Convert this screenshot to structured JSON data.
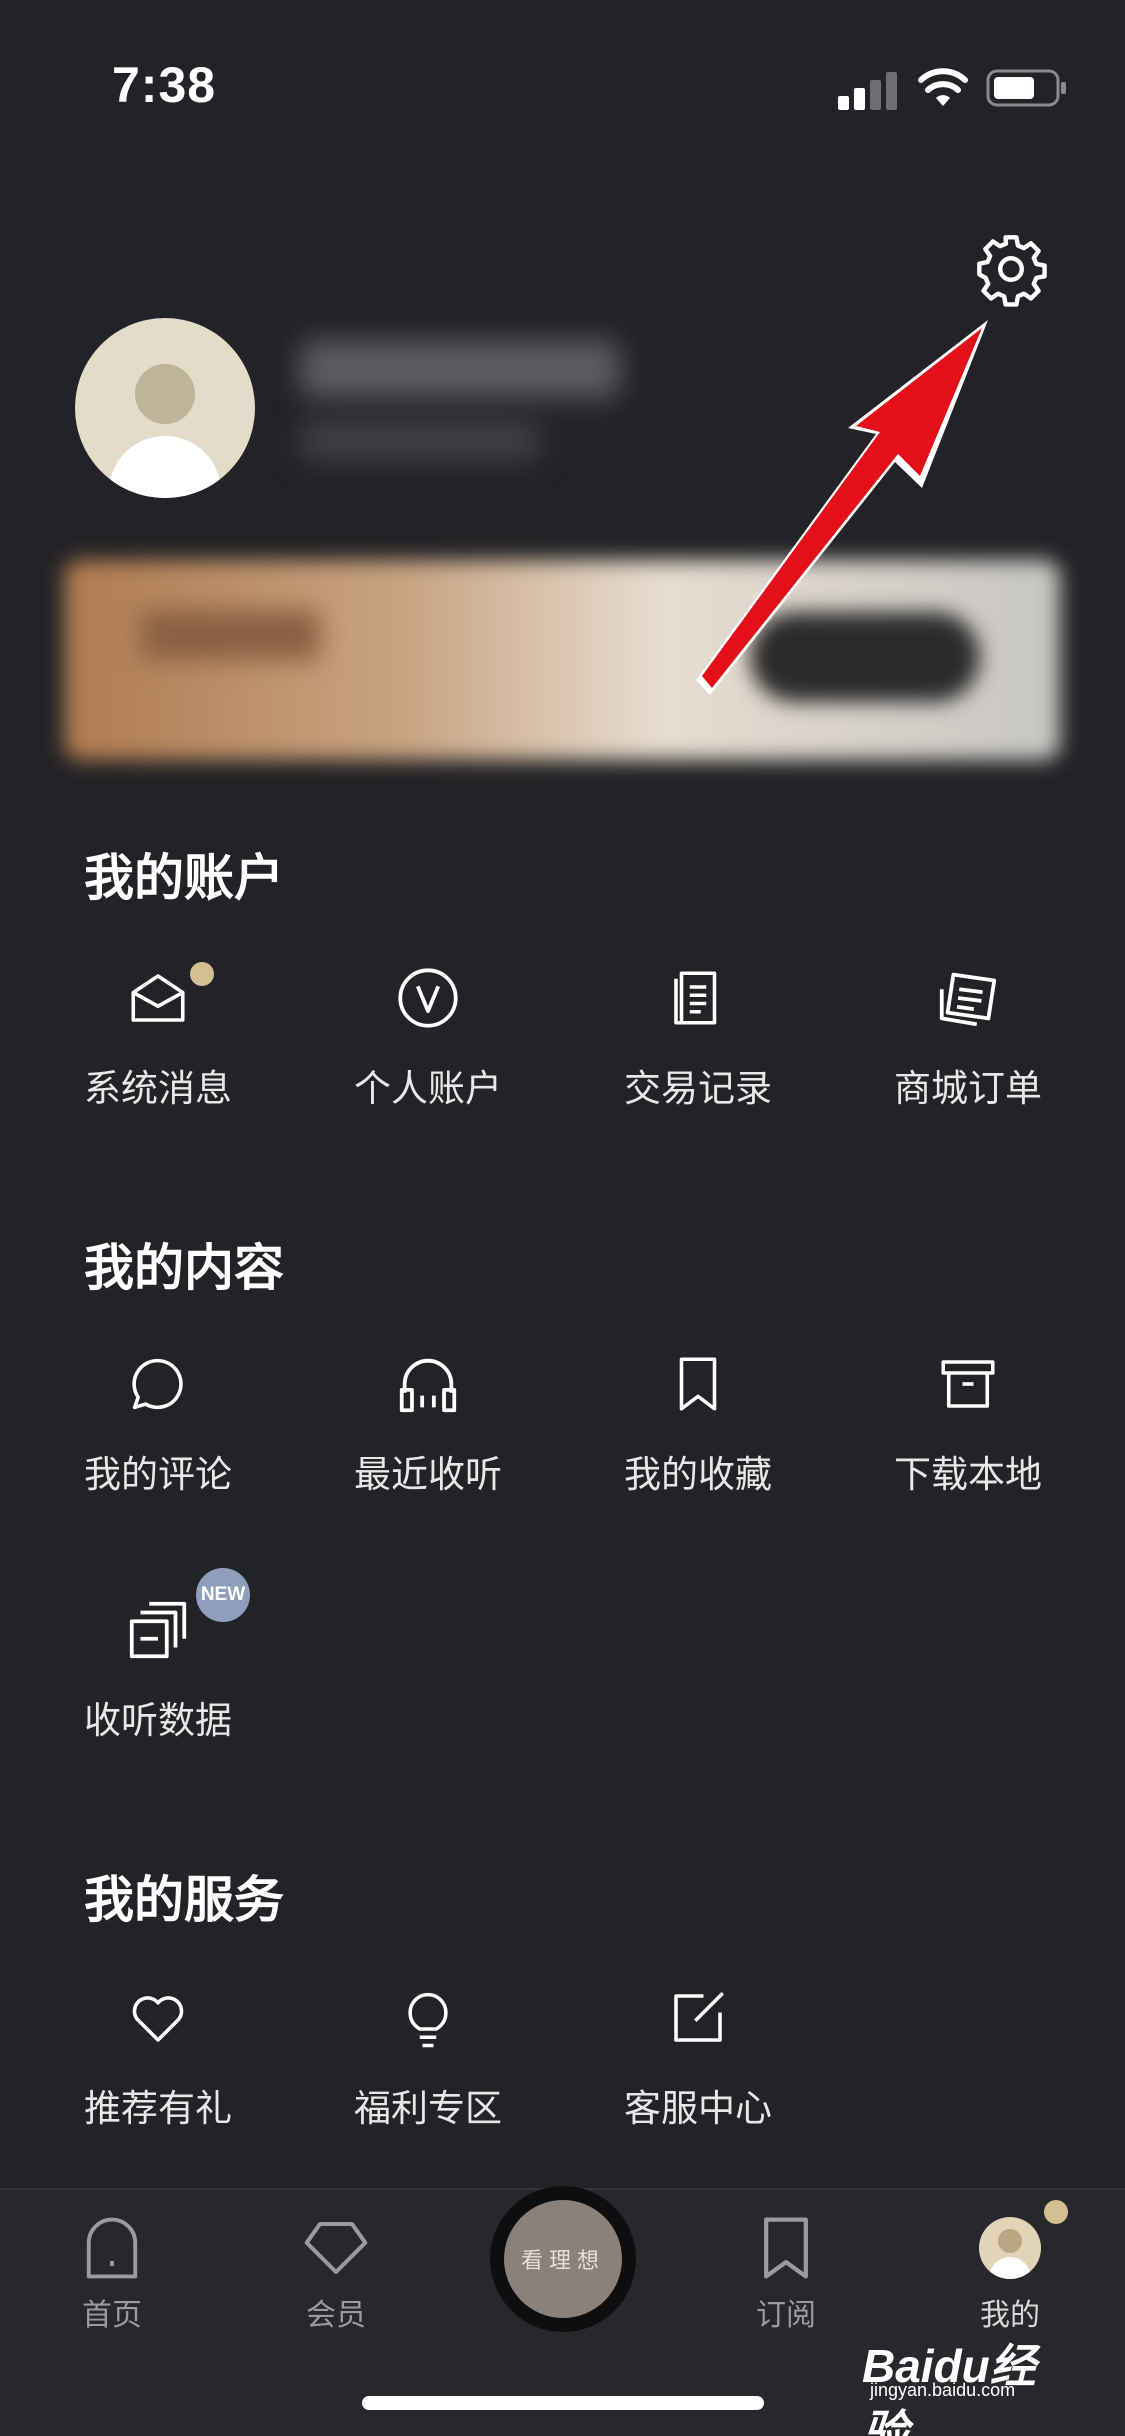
{
  "status_bar": {
    "time": "7:38",
    "signal_icon": "cellular-signal-icon",
    "wifi_icon": "wifi-icon",
    "battery_icon": "battery-icon"
  },
  "header": {
    "settings_icon": "gear-icon"
  },
  "sections": {
    "account": {
      "title": "我的账户",
      "items": [
        {
          "label": "系统消息",
          "icon": "mail-open-icon",
          "has_dot": true
        },
        {
          "label": "个人账户",
          "icon": "v-circle-icon"
        },
        {
          "label": "交易记录",
          "icon": "receipt-icon"
        },
        {
          "label": "商城订单",
          "icon": "order-list-icon"
        }
      ]
    },
    "content": {
      "title": "我的内容",
      "items": [
        {
          "label": "我的评论",
          "icon": "chat-bubble-icon"
        },
        {
          "label": "最近收听",
          "icon": "headphones-icon"
        },
        {
          "label": "我的收藏",
          "icon": "bookmark-icon"
        },
        {
          "label": "下载本地",
          "icon": "archive-box-icon"
        },
        {
          "label": "收听数据",
          "icon": "stacked-cards-icon",
          "badge": "NEW"
        }
      ]
    },
    "services": {
      "title": "我的服务",
      "items": [
        {
          "label": "推荐有礼",
          "icon": "heart-icon"
        },
        {
          "label": "福利专区",
          "icon": "lightbulb-icon"
        },
        {
          "label": "客服中心",
          "icon": "edit-square-icon"
        }
      ]
    }
  },
  "tab_bar": {
    "tabs": [
      {
        "label": "首页",
        "icon": "arch-door-icon"
      },
      {
        "label": "会员",
        "icon": "pentagon-icon"
      },
      {
        "label": "订阅",
        "icon": "bookmark-icon"
      },
      {
        "label": "我的",
        "icon": "avatar-icon",
        "active": true
      }
    ],
    "center_button": "看理想"
  },
  "watermark": {
    "logo": "Baidu经验",
    "url": "jingyan.baidu.com"
  },
  "colors": {
    "background": "#222326",
    "accent_gold": "#d4bf93",
    "badge_blue": "#8e9fbd",
    "annotation_red": "#e3101a"
  }
}
